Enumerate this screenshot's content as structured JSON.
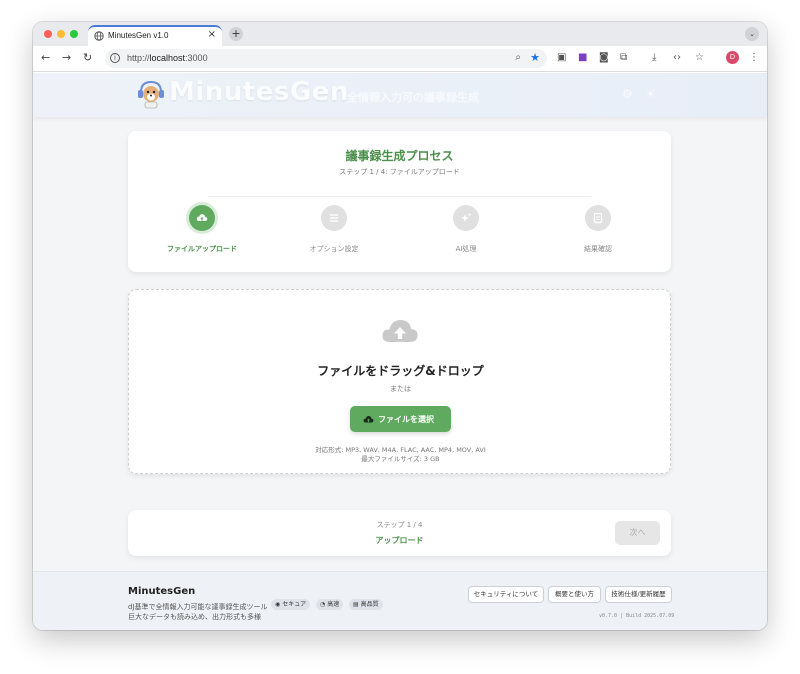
{
  "browser": {
    "tab_title": "MinutesGen v1.0",
    "tab_close": "×",
    "new_tab": "+",
    "tab_menu": "⌄",
    "url_scheme": "http://",
    "url_host": "localhost",
    "url_port": ":3000",
    "avatar_letter": "D",
    "nav_back": "←",
    "nav_forward": "→",
    "nav_reload": "↻"
  },
  "header": {
    "brand": "MinutesGen",
    "subtitle": "全情報入力可の議事録生成"
  },
  "process": {
    "title": "議事録生成プロセス",
    "subtitle": "ステップ 1 / 4: ファイルアップロード",
    "steps": [
      {
        "label": "ファイルアップロード",
        "icon": "cloud-upload-icon",
        "active": true
      },
      {
        "label": "オプション設定",
        "icon": "sliders-icon",
        "active": false
      },
      {
        "label": "AI処理",
        "icon": "sparkle-icon",
        "active": false
      },
      {
        "label": "結果確認",
        "icon": "document-icon",
        "active": false
      }
    ]
  },
  "upload": {
    "title": "ファイルをドラッグ&ドロップ",
    "or": "または",
    "button": "ファイルを選択",
    "formats": "対応形式: MP3, WAV, M4A, FLAC, AAC, MP4, MOV, AVI",
    "max_size": "最大ファイルサイズ: 3 GB"
  },
  "navigation": {
    "step_text": "ステップ 1 / 4",
    "stage": "アップロード",
    "next": "次へ",
    "next_enabled": false
  },
  "footer": {
    "brand": "MinutesGen",
    "desc_line1": "dJ基準で全情報入力可能な議事録生成ツール",
    "desc_line2": "巨大なデータも読み込め、出力形式も多様",
    "badges": [
      {
        "icon": "globe-icon",
        "label": "セキュア"
      },
      {
        "icon": "speed-icon",
        "label": "高速"
      },
      {
        "icon": "quality-icon",
        "label": "高品質"
      }
    ],
    "links": [
      "セキュリティについて",
      "概要と使い方",
      "技術仕様/更新履歴"
    ],
    "version": "v0.7.0 | Build 2025.07.09"
  },
  "colors": {
    "accent": "#5faa5f",
    "accent_text": "#4a8f4a",
    "inactive": "#e0e0e0",
    "link_blue": "#1a73e8"
  }
}
